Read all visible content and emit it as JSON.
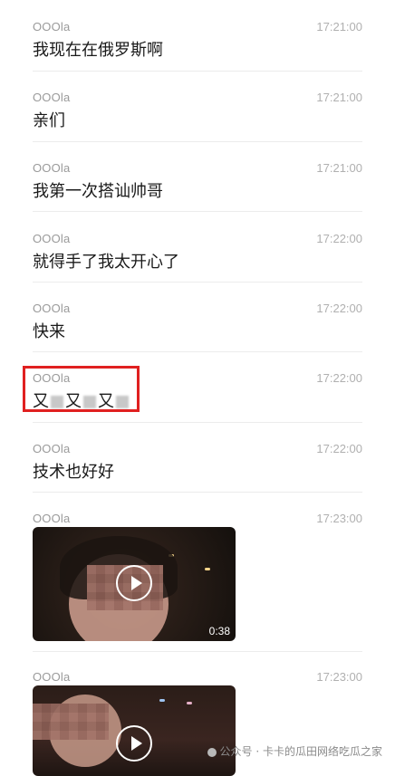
{
  "messages": [
    {
      "sender": "OOOla",
      "time": "17:21:00",
      "text": "我现在在俄罗斯啊"
    },
    {
      "sender": "OOOla",
      "time": "17:21:00",
      "text": "亲们"
    },
    {
      "sender": "OOOla",
      "time": "17:21:00",
      "text": "我第一次搭讪帅哥"
    },
    {
      "sender": "OOOla",
      "time": "17:22:00",
      "text": "就得手了我太开心了"
    },
    {
      "sender": "OOOla",
      "time": "17:22:00",
      "text": "快来"
    },
    {
      "sender": "OOOla",
      "time": "17:22:00",
      "text_parts": [
        "又",
        "又",
        "又"
      ]
    },
    {
      "sender": "OOOla",
      "time": "17:22:00",
      "text": "技术也好好"
    },
    {
      "sender": "OOOla",
      "time": "17:23:00",
      "video_duration": "0:38"
    },
    {
      "sender": "OOOla",
      "time": "17:23:00"
    }
  ],
  "watermark": {
    "text": "公众号 · 卡卡的瓜田网络吃瓜之家",
    "icon": "wechat-icon"
  },
  "colors": {
    "highlight": "#e02020",
    "sender": "#9a9a9a",
    "time": "#b0b0b0",
    "text": "#1a1a1a"
  }
}
